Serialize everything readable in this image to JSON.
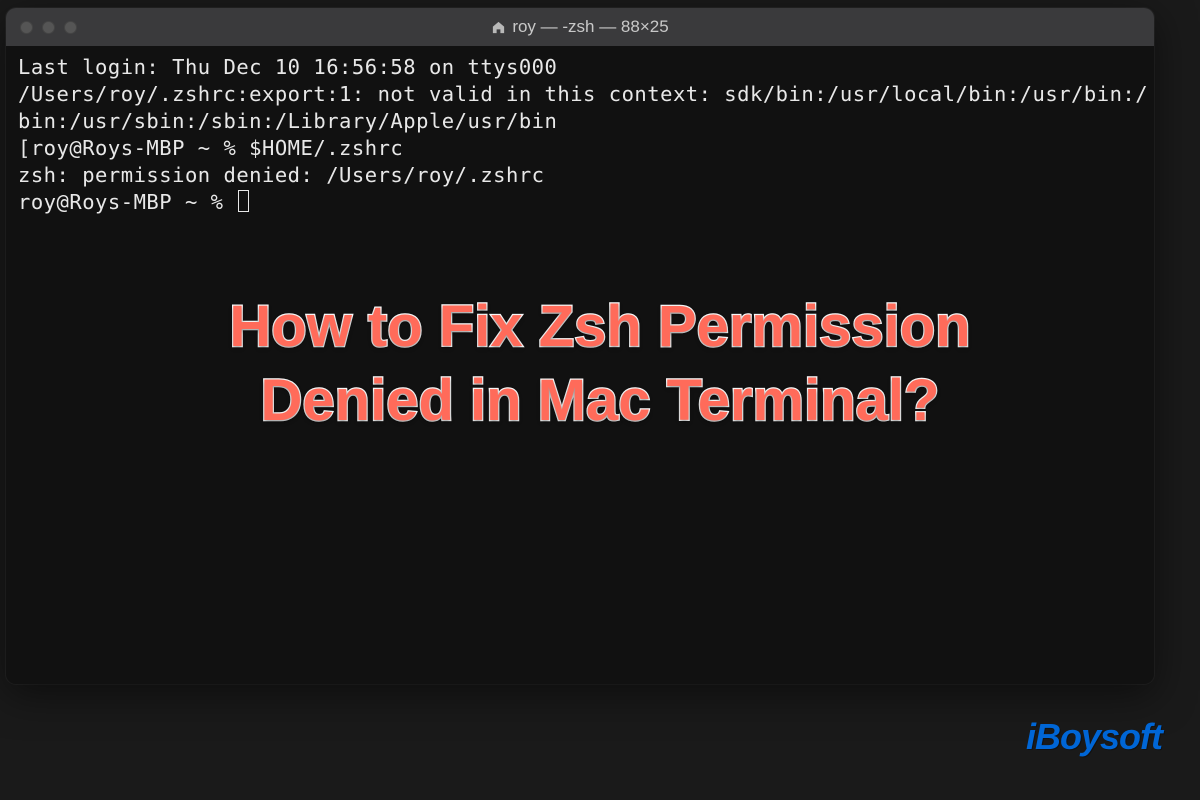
{
  "window": {
    "title": "roy — -zsh — 88×25"
  },
  "terminal": {
    "lines": [
      "Last login: Thu Dec 10 16:56:58 on ttys000",
      "/Users/roy/.zshrc:export:1: not valid in this context: sdk/bin:/usr/local/bin:/usr/bin:/",
      "bin:/usr/sbin:/sbin:/Library/Apple/usr/bin",
      "[roy@Roys-MBP ~ % $HOME/.zshrc",
      "zsh: permission denied: /Users/roy/.zshrc",
      "roy@Roys-MBP ~ % "
    ]
  },
  "overlay": {
    "headline_line1": "How to Fix Zsh Permission",
    "headline_line2": "Denied in Mac Terminal?"
  },
  "brand": {
    "name": "iBoysoft"
  }
}
